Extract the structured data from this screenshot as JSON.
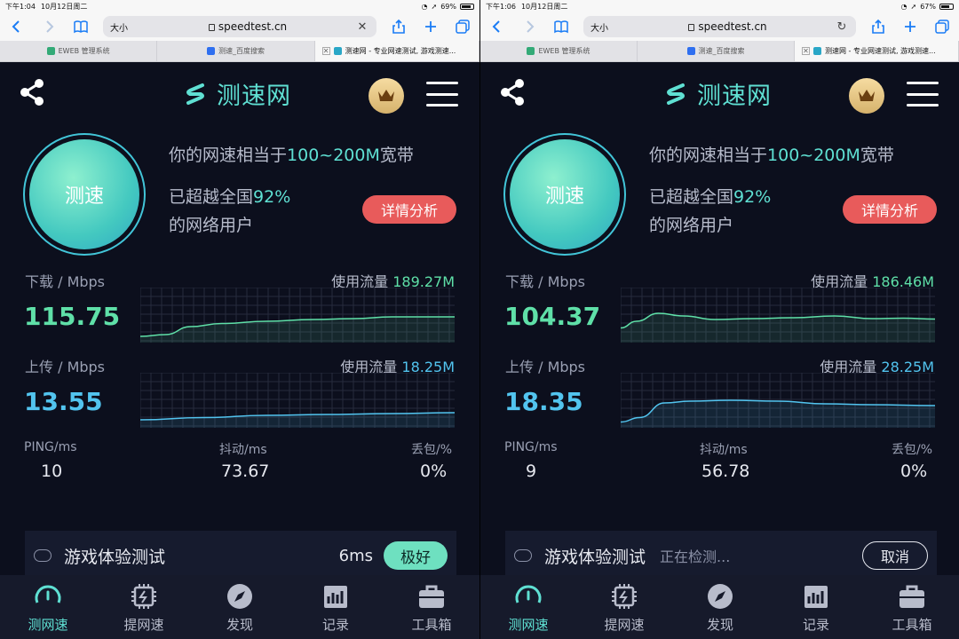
{
  "screens": [
    {
      "status": {
        "time": "下午1:04",
        "date": "10月12日周二",
        "battery": "69%",
        "battery_level": 0.69
      },
      "browser": {
        "aa": "大小",
        "url": "speedtest.cn",
        "right_icon": "close-icon"
      },
      "tabs": [
        "EWEB 管理系统",
        "测速_百度搜索",
        "测速网 - 专业网速测试, 游戏测速..."
      ],
      "app": {
        "title": "测速网",
        "start_button": "测速",
        "summary_prefix": "你的网速相当于",
        "summary_range": "100~200M",
        "summary_suffix": "宽带",
        "beat_prefix": "已超越全国",
        "beat_pct": "92%",
        "beat_suffix": "的网络用户",
        "detail_button": "详情分析"
      },
      "download": {
        "label": "下载 / Mbps",
        "usage_label": "使用流量",
        "usage": "189.27M",
        "value": "115.75"
      },
      "upload": {
        "label": "上传 / Mbps",
        "usage_label": "使用流量",
        "usage": "18.25M",
        "value": "13.55"
      },
      "ping": {
        "ping_label": "PING/ms",
        "ping": "10",
        "jitter_label": "抖动/ms",
        "jitter": "73.67",
        "loss_label": "丢包/%",
        "loss": "0%"
      },
      "game": {
        "title": "游戏体验测试",
        "ms": "6ms",
        "rating": "极好"
      },
      "nav": [
        "测网速",
        "提网速",
        "发现",
        "记录",
        "工具箱"
      ]
    },
    {
      "status": {
        "time": "下午1:06",
        "date": "10月12日周二",
        "battery": "67%",
        "battery_level": 0.67
      },
      "browser": {
        "aa": "大小",
        "url": "speedtest.cn",
        "right_icon": "reload-icon"
      },
      "tabs": [
        "EWEB 管理系统",
        "测速_百度搜索",
        "测速网 - 专业网速测试, 游戏测速..."
      ],
      "app": {
        "title": "测速网",
        "start_button": "测速",
        "summary_prefix": "你的网速相当于",
        "summary_range": "100~200M",
        "summary_suffix": "宽带",
        "beat_prefix": "已超越全国",
        "beat_pct": "92%",
        "beat_suffix": "的网络用户",
        "detail_button": "详情分析"
      },
      "download": {
        "label": "下载 / Mbps",
        "usage_label": "使用流量",
        "usage": "186.46M",
        "value": "104.37"
      },
      "upload": {
        "label": "上传 / Mbps",
        "usage_label": "使用流量",
        "usage": "28.25M",
        "value": "18.35"
      },
      "ping": {
        "ping_label": "PING/ms",
        "ping": "9",
        "jitter_label": "抖动/ms",
        "jitter": "56.78",
        "loss_label": "丢包/%",
        "loss": "0%"
      },
      "game": {
        "title": "游戏体验测试",
        "status": "正在检测...",
        "cancel": "取消"
      },
      "nav": [
        "测网速",
        "提网速",
        "发现",
        "记录",
        "工具箱"
      ]
    }
  ],
  "colors": {
    "accent": "#5fe0d3",
    "download": "#5fe0a8",
    "upload": "#52c4ef",
    "danger": "#e85b5b"
  }
}
